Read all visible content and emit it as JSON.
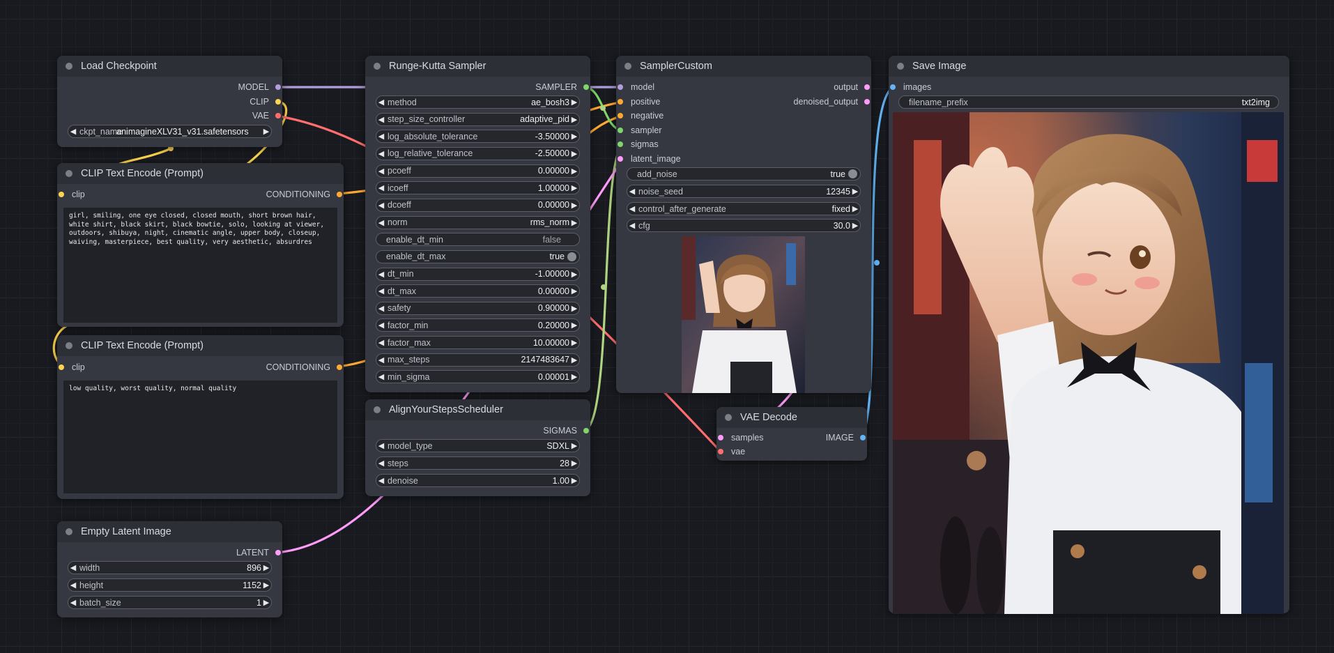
{
  "colors": {
    "model": "#b39ddb",
    "clip": "#ffd54f",
    "vae": "#ff6e6e",
    "conditioning": "#ffa931",
    "latent": "#ff9cf9",
    "sigmas": "#aed581",
    "sampler": "#7fd66a",
    "image": "#64b5f6",
    "noise": "#aaaaaa"
  },
  "nodes": {
    "load_checkpoint": {
      "title": "Load Checkpoint",
      "outputs": [
        "MODEL",
        "CLIP",
        "VAE"
      ],
      "widgets": [
        {
          "label": "ckpt_name",
          "value": "animagineXLV31_v31.safetensors"
        }
      ]
    },
    "clip_pos": {
      "title": "CLIP Text Encode (Prompt)",
      "input": "clip",
      "output": "CONDITIONING",
      "text": "girl, smiling, one eye closed, closed mouth, short brown hair, white shirt, black skirt, black bowtie, solo, looking at viewer, outdoors, shibuya, night, cinematic angle, upper body, closeup, waiving, masterpiece, best quality, very aesthetic, absurdres"
    },
    "clip_neg": {
      "title": "CLIP Text Encode (Prompt)",
      "input": "clip",
      "output": "CONDITIONING",
      "text": "low quality, worst quality, normal quality"
    },
    "empty_latent": {
      "title": "Empty Latent Image",
      "output": "LATENT",
      "widgets": [
        {
          "label": "width",
          "value": "896"
        },
        {
          "label": "height",
          "value": "1152"
        },
        {
          "label": "batch_size",
          "value": "1"
        }
      ]
    },
    "rk_sampler": {
      "title": "Runge-Kutta Sampler",
      "output": "SAMPLER",
      "widgets": [
        {
          "label": "method",
          "value": "ae_bosh3",
          "kind": "number"
        },
        {
          "label": "step_size_controller",
          "value": "adaptive_pid",
          "kind": "number"
        },
        {
          "label": "log_absolute_tolerance",
          "value": "-3.50000",
          "kind": "number"
        },
        {
          "label": "log_relative_tolerance",
          "value": "-2.50000",
          "kind": "number"
        },
        {
          "label": "pcoeff",
          "value": "0.00000",
          "kind": "number"
        },
        {
          "label": "icoeff",
          "value": "1.00000",
          "kind": "number"
        },
        {
          "label": "dcoeff",
          "value": "0.00000",
          "kind": "number"
        },
        {
          "label": "norm",
          "value": "rms_norm",
          "kind": "number"
        },
        {
          "label": "enable_dt_min",
          "value": "false",
          "kind": "toggle",
          "on": false
        },
        {
          "label": "enable_dt_max",
          "value": "true",
          "kind": "toggle",
          "on": true
        },
        {
          "label": "dt_min",
          "value": "-1.00000",
          "kind": "number"
        },
        {
          "label": "dt_max",
          "value": "0.00000",
          "kind": "number"
        },
        {
          "label": "safety",
          "value": "0.90000",
          "kind": "number"
        },
        {
          "label": "factor_min",
          "value": "0.20000",
          "kind": "number"
        },
        {
          "label": "factor_max",
          "value": "10.00000",
          "kind": "number"
        },
        {
          "label": "max_steps",
          "value": "2147483647",
          "kind": "number"
        },
        {
          "label": "min_sigma",
          "value": "0.00001",
          "kind": "number"
        }
      ]
    },
    "ays": {
      "title": "AlignYourStepsScheduler",
      "output": "SIGMAS",
      "widgets": [
        {
          "label": "model_type",
          "value": "SDXL"
        },
        {
          "label": "steps",
          "value": "28"
        },
        {
          "label": "denoise",
          "value": "1.00"
        }
      ]
    },
    "sampler_custom": {
      "title": "SamplerCustom",
      "inputs": [
        "model",
        "positive",
        "negative",
        "sampler",
        "sigmas",
        "latent_image"
      ],
      "outputs": [
        "output",
        "denoised_output"
      ],
      "widgets": [
        {
          "label": "add_noise",
          "value": "true",
          "kind": "toggle",
          "on": true
        },
        {
          "label": "noise_seed",
          "value": "12345",
          "kind": "number"
        },
        {
          "label": "control_after_generate",
          "value": "fixed",
          "kind": "number"
        },
        {
          "label": "cfg",
          "value": "30.0",
          "kind": "number"
        }
      ]
    },
    "vae_decode": {
      "title": "VAE Decode",
      "inputs": [
        "samples",
        "vae"
      ],
      "output": "IMAGE"
    },
    "save_image": {
      "title": "Save Image",
      "input": "images",
      "widgets": [
        {
          "label": "filename_prefix",
          "value": "txt2img"
        }
      ]
    }
  }
}
